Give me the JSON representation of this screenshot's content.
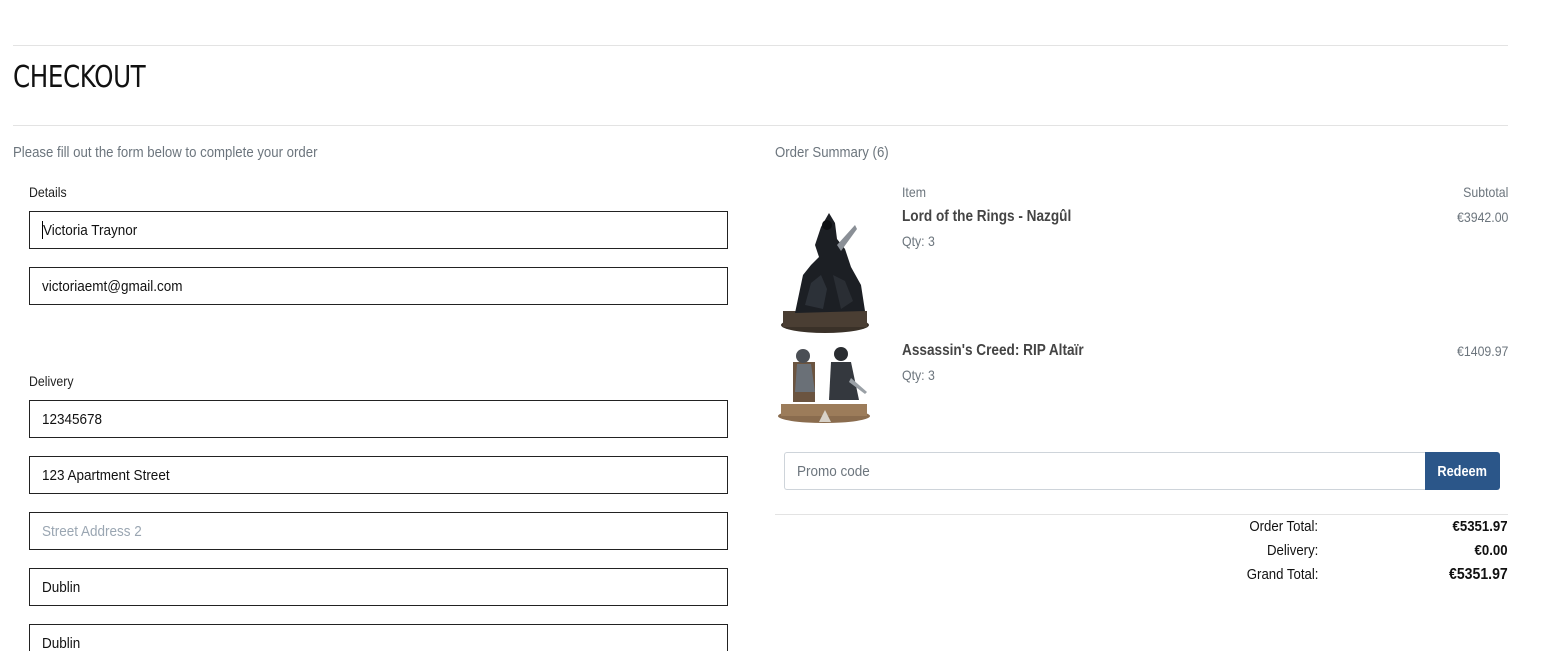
{
  "page": {
    "title": "CHECKOUT",
    "form_intro": "Please fill out the form below to complete your order"
  },
  "details": {
    "section_label": "Details",
    "full_name": "Victoria Traynor",
    "email": "victoriaemt@gmail.com"
  },
  "delivery": {
    "section_label": "Delivery",
    "phone": "12345678",
    "street_address_1": "123 Apartment Street",
    "street_address_2_placeholder": "Street Address 2",
    "town_or_city": "Dublin",
    "county": "Dublin"
  },
  "summary": {
    "heading": "Order Summary (6)",
    "col_item": "Item",
    "col_subtotal": "Subtotal",
    "items": [
      {
        "name": "Lord of the Rings - Nazgûl",
        "qty": "Qty: 3",
        "subtotal": "€3942.00",
        "image_icon": "nazgul-statue-image"
      },
      {
        "name": "Assassin's Creed: RIP Altaïr",
        "qty": "Qty: 3",
        "subtotal": "€1409.97",
        "image_icon": "altair-statue-image"
      }
    ],
    "promo_placeholder": "Promo code",
    "promo_button": "Redeem",
    "order_total_label": "Order Total:",
    "order_total_value": "€5351.97",
    "delivery_label": "Delivery:",
    "delivery_value": "€0.00",
    "grand_total_label": "Grand Total:",
    "grand_total_value": "€5351.97"
  },
  "colors": {
    "accent_button": "#2b5689",
    "muted_text": "#6c757d",
    "divider": "#e3e3e3"
  }
}
